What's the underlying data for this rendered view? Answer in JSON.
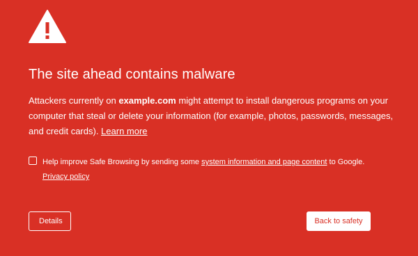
{
  "heading": "The site ahead contains malware",
  "message": {
    "before": "Attackers currently on ",
    "domain": "example.com",
    "after": " might attempt to install dangerous programs on your computer that steal or delete your information (for example, photos, passwords, messages, and credit cards). ",
    "learn_more": "Learn more"
  },
  "optin": {
    "checked": false,
    "before": "Help improve Safe Browsing by sending some ",
    "link": "system information and page content",
    "after": " to Google.",
    "privacy_link": "Privacy policy"
  },
  "buttons": {
    "details": "Details",
    "back_to_safety": "Back to safety"
  },
  "colors": {
    "background": "#d93025",
    "text": "#ffffff",
    "icon_mark": "#d93025"
  },
  "icons": {
    "warning": "warning-triangle-icon"
  }
}
